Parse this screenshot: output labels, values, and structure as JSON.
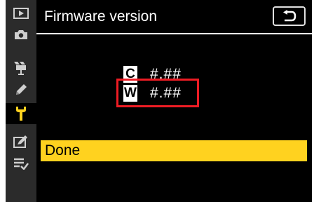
{
  "header": {
    "title": "Firmware version",
    "back_icon": "return-arrow-icon"
  },
  "sidebar": {
    "items": [
      {
        "name": "playback-menu",
        "icon": "playback-icon"
      },
      {
        "name": "photo-shooting-menu",
        "icon": "camera-icon"
      },
      {
        "name": "movie-shooting-menu",
        "icon": "movie-camera-icon"
      },
      {
        "name": "custom-settings-menu",
        "icon": "pencil-icon"
      },
      {
        "name": "setup-menu",
        "icon": "wrench-icon",
        "active": true
      },
      {
        "name": "retouch-menu",
        "icon": "retouch-icon"
      },
      {
        "name": "my-menu",
        "icon": "my-menu-icon"
      }
    ]
  },
  "firmware": {
    "camera": {
      "badge": "C",
      "version": "#.##"
    },
    "wireless": {
      "badge": "W",
      "version": "#.##"
    }
  },
  "menu": {
    "done_label": "Done"
  },
  "colors": {
    "background": "#000000",
    "sidebar": "#2b2b2b",
    "highlight": "#ffd21f",
    "active_icon": "#ffd21f",
    "frame": "#ee1c24"
  }
}
